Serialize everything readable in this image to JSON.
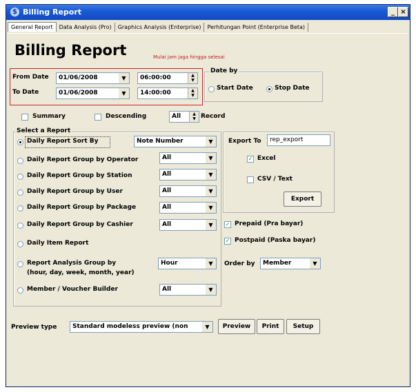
{
  "window": {
    "title": "Billing Report"
  },
  "tabs": [
    "General Report",
    "Data Analysis (Pro)",
    "Graphics Analysis (Enterprise)",
    "Perhitungan Point (Enterprise Beta)"
  ],
  "header": {
    "title": "Billing Report",
    "hint": "Mulai jam jaga hingga selesai"
  },
  "dates": {
    "from_label": "From Date",
    "from_date": "01/06/2008",
    "from_time": "06:00:00",
    "to_label": "To Date",
    "to_date": "01/06/2008",
    "to_time": "14:00:00"
  },
  "date_by": {
    "label": "Date by",
    "start": "Start Date",
    "stop": "Stop Date",
    "selected": "stop"
  },
  "options": {
    "summary": "Summary",
    "descending": "Descending",
    "count_value": "All",
    "record": "Record"
  },
  "report": {
    "group_label": "Select a Report",
    "items": [
      {
        "label": "Daily Report Sort By",
        "value": "Note Number",
        "selected": true
      },
      {
        "label": "Daily Report Group by Operator",
        "value": "All"
      },
      {
        "label": "Daily Report Group by  Station",
        "value": "All"
      },
      {
        "label": "Daily Report Group by User",
        "value": "All"
      },
      {
        "label": "Daily Report Group by Package",
        "value": "All"
      },
      {
        "label": "Daily Report Group by Cashier",
        "value": "All"
      },
      {
        "label": "Daily Item Report",
        "value": ""
      },
      {
        "label": "Report Analysis Group by",
        "label2": "(hour, day, week, month, year)",
        "value": "Hour"
      },
      {
        "label": "Member / Voucher Builder",
        "value": "All"
      }
    ]
  },
  "export": {
    "label": "Export To",
    "filename": "rep_export",
    "excel": "Excel",
    "excel_checked": true,
    "csv": "CSV / Text",
    "csv_checked": false,
    "button": "Export"
  },
  "filters": {
    "prepaid": "Prepaid (Pra bayar)",
    "prepaid_checked": true,
    "postpaid": "Postpaid (Paska bayar)",
    "postpaid_checked": true,
    "order_label": "Order by",
    "order_value": "Member"
  },
  "footer": {
    "preview_type_label": "Preview type",
    "preview_type_value": "Standard modeless preview (non",
    "preview": "Preview",
    "print": "Print",
    "setup": "Setup"
  },
  "colors": {
    "titlebar": "#1a5bd6",
    "hint": "#c02020",
    "window_bg": "#ece9d8"
  },
  "icons": {
    "app": "app-icon",
    "minimize": "minimize-icon",
    "close": "close-icon",
    "dropdown": "chevron-down-icon"
  }
}
